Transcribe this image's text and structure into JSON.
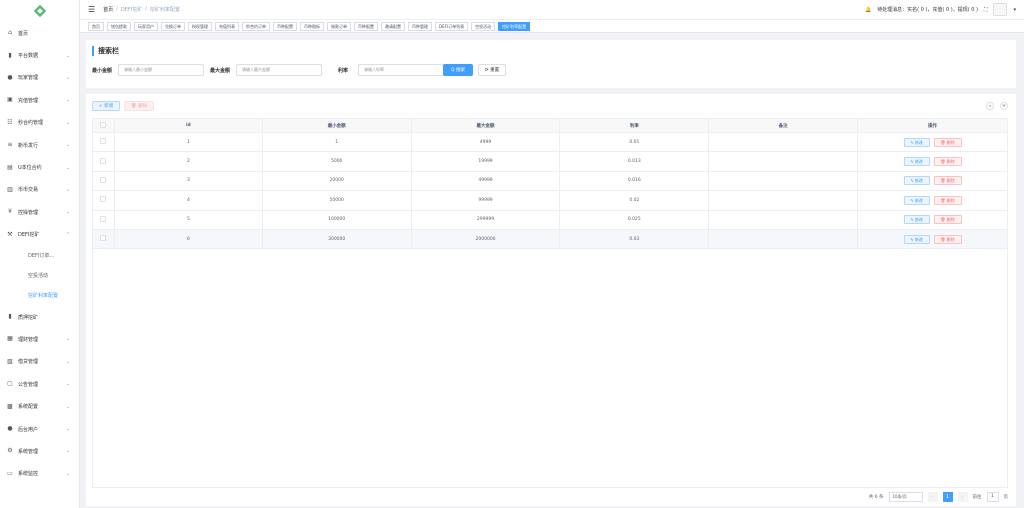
{
  "sidebar": {
    "items": [
      {
        "label": "首页",
        "icon": "home-icon",
        "glyph": "⌂"
      },
      {
        "label": "平台数据",
        "icon": "chart-icon",
        "glyph": "▮"
      },
      {
        "label": "玩家管理",
        "icon": "user-icon",
        "glyph": "●"
      },
      {
        "label": "充值管理",
        "icon": "wallet-icon",
        "glyph": "▣"
      },
      {
        "label": "秒合约管理",
        "icon": "contract-icon",
        "glyph": "☷"
      },
      {
        "label": "新币发行",
        "icon": "coin-icon",
        "glyph": "≡"
      },
      {
        "label": "U本位合约",
        "icon": "ucontract-icon",
        "glyph": "▤"
      },
      {
        "label": "币币交易",
        "icon": "exchange-icon",
        "glyph": "▥"
      },
      {
        "label": "控操管理",
        "icon": "yen-icon",
        "glyph": "¥"
      },
      {
        "label": "DEFI挖矿",
        "icon": "mining-icon",
        "glyph": "⚒"
      }
    ],
    "sub_items": [
      {
        "label": "DEFI订单..."
      },
      {
        "label": "空投活动"
      },
      {
        "label": "挖矿利率配置"
      }
    ],
    "items2": [
      {
        "label": "质押挖矿",
        "icon": "stake-icon",
        "glyph": "▮"
      },
      {
        "label": "理财管理",
        "icon": "finance-icon",
        "glyph": "▦"
      },
      {
        "label": "借贷管理",
        "icon": "loan-icon",
        "glyph": "▧"
      },
      {
        "label": "公告管理",
        "icon": "notice-icon",
        "glyph": "▢"
      },
      {
        "label": "系统配置",
        "icon": "config-icon",
        "glyph": "▩"
      },
      {
        "label": "后台用户",
        "icon": "admin-icon",
        "glyph": "●"
      },
      {
        "label": "系统管理",
        "icon": "gear-icon",
        "glyph": "⚙"
      },
      {
        "label": "系统监控",
        "icon": "monitor-icon",
        "glyph": "▭"
      }
    ]
  },
  "topbar": {
    "crumbs": [
      "首页",
      "DEFI挖矿",
      "挖矿利率配置"
    ],
    "status_text": "待处理消息：实名( 0 )，充值( 0 )，提现( 0 )"
  },
  "tags": [
    "首页",
    "钱包提款",
    "玩家用户",
    "兑换订单",
    "授权管理",
    "充值列表",
    "秒合约订单",
    "币种配置",
    "币种图标",
    "借款订单",
    "币种配置",
    "邀请配置",
    "币种管理",
    "DEFI订单列表",
    "空投活动",
    "挖矿利率配置"
  ],
  "search": {
    "title": "搜索栏",
    "min_label": "最小金额",
    "min_placeholder": "请输入最小金额",
    "max_label": "最大金额",
    "max_placeholder": "请输入最大金额",
    "rate_label": "利率",
    "rate_placeholder": "请输入利率",
    "search_btn": "Q 搜索",
    "reset_btn": "⟳ 重置"
  },
  "toolbar": {
    "add": "+ 新增",
    "delete": "🗑 删除"
  },
  "table": {
    "headers": [
      "id",
      "最小金额",
      "最大金额",
      "利率",
      "备注",
      "操作"
    ],
    "edit_label": "✎ 修改",
    "delete_label": "🗑 删除",
    "rows": [
      {
        "id": "1",
        "min": "1",
        "max": "4999",
        "rate": "0.01",
        "note": ""
      },
      {
        "id": "2",
        "min": "5000",
        "max": "19999",
        "rate": "0.013",
        "note": ""
      },
      {
        "id": "3",
        "min": "20000",
        "max": "49999",
        "rate": "0.016",
        "note": ""
      },
      {
        "id": "4",
        "min": "50000",
        "max": "99999",
        "rate": "0.02",
        "note": ""
      },
      {
        "id": "5",
        "min": "100000",
        "max": "299999",
        "rate": "0.025",
        "note": ""
      },
      {
        "id": "6",
        "min": "300000",
        "max": "2000000",
        "rate": "0.03",
        "note": ""
      }
    ]
  },
  "pager": {
    "total": "共 6 条",
    "size": "10条/页",
    "current": "1",
    "goto": "前往",
    "page": "1",
    "unit": "页"
  }
}
